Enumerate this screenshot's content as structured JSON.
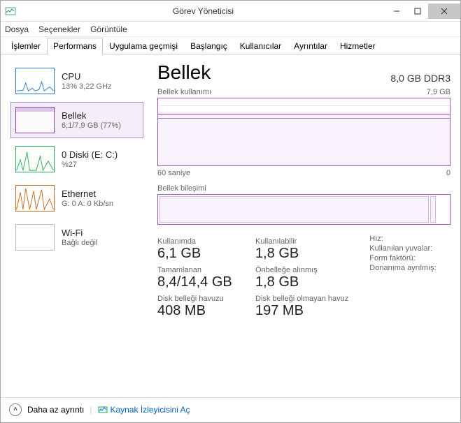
{
  "window": {
    "title": "Görev Yöneticisi"
  },
  "menu": {
    "file": "Dosya",
    "options": "Seçenekler",
    "view": "Görüntüle"
  },
  "tabs": {
    "processes": "İşlemler",
    "performance": "Performans",
    "apphistory": "Uygulama geçmişi",
    "startup": "Başlangıç",
    "users": "Kullanıcılar",
    "details": "Ayrıntılar",
    "services": "Hizmetler"
  },
  "sidebar": {
    "cpu": {
      "label": "CPU",
      "sub": "13% 3,22 GHz"
    },
    "memory": {
      "label": "Bellek",
      "sub": "6,1/7,9 GB (77%)"
    },
    "disk": {
      "label": "0 Diski (E: C:)",
      "sub": "%27"
    },
    "ethernet": {
      "label": "Ethernet",
      "sub": "G: 0 A: 0 Kb/sn"
    },
    "wifi": {
      "label": "Wi-Fi",
      "sub": "Bağlı değil"
    }
  },
  "main": {
    "title": "Bellek",
    "capacity": "8,0 GB DDR3",
    "usage_label": "Bellek kullanımı",
    "usage_max": "7,9 GB",
    "axis_left": "60 saniye",
    "axis_right": "0",
    "composition_label": "Bellek bileşimi"
  },
  "stats": {
    "inuse_label": "Kullanımda",
    "inuse_value": "6,1 GB",
    "available_label": "Kullanılabilir",
    "available_value": "1,8 GB",
    "committed_label": "Tamamlanan",
    "committed_value": "8,4/14,4 GB",
    "cached_label": "Önbelleğe alınmış",
    "cached_value": "1,8 GB",
    "paged_label": "Disk belleği havuzu",
    "paged_value": "408 MB",
    "nonpaged_label": "Disk belleği olmayan havuz",
    "nonpaged_value": "197 MB",
    "speed_label": "Hız:",
    "slots_label": "Kullanılan yuvalar:",
    "form_label": "Form faktörü:",
    "reserved_label": "Donanıma ayrılmış:"
  },
  "footer": {
    "fewer": "Daha az ayrıntı",
    "resmon": "Kaynak İzleyicisini Aç"
  },
  "chart_data": {
    "type": "area",
    "title": "Bellek kullanımı",
    "ylabel": "GB",
    "ylim": [
      0,
      7.9
    ],
    "x_range_seconds": 60,
    "series": [
      {
        "name": "Kullanımda",
        "approx_value_gb": 6.1
      }
    ],
    "composition": {
      "total_gb": 8.0,
      "in_use_gb": 6.1,
      "available_gb": 1.8,
      "cached_gb": 1.8
    }
  }
}
